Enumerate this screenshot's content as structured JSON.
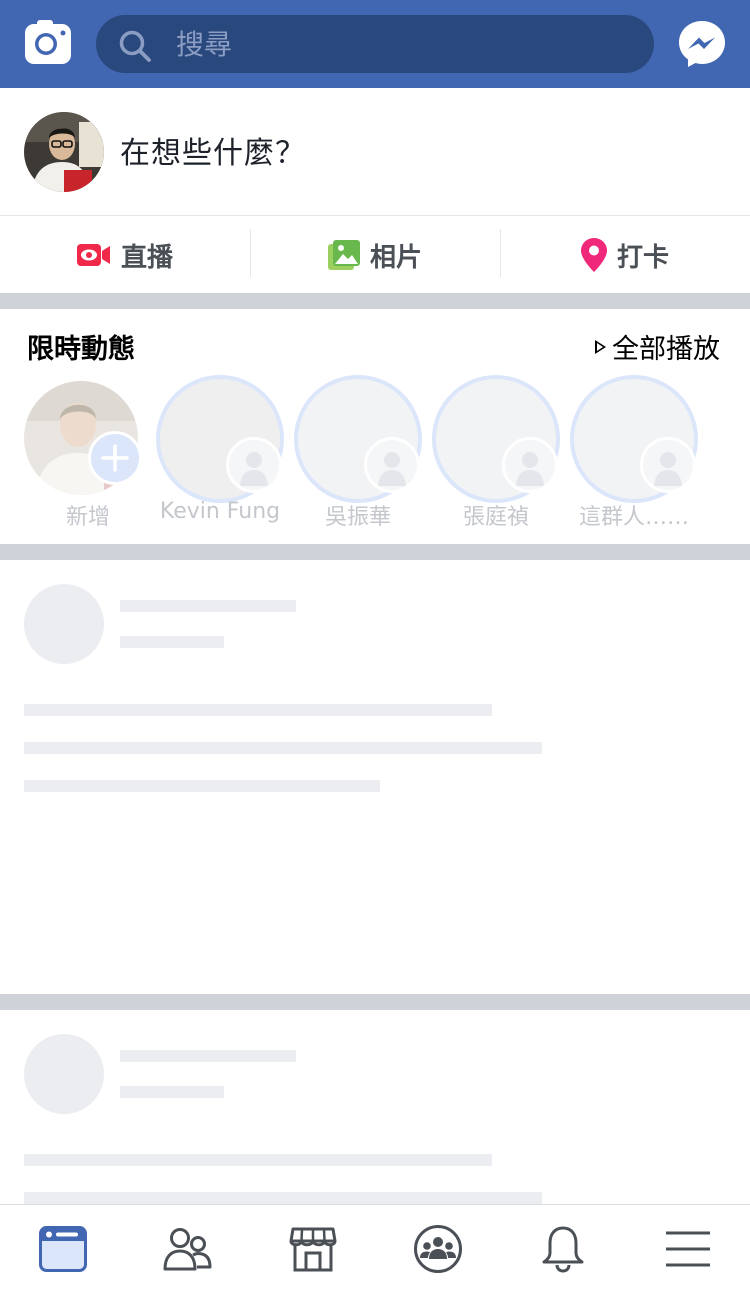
{
  "header": {
    "camera_icon": "camera-icon",
    "search": {
      "placeholder": "搜尋",
      "value": ""
    },
    "messenger_icon": "messenger-icon",
    "bar_color": "#4267b2"
  },
  "composer": {
    "prompt": "在想些什麼？"
  },
  "actions": [
    {
      "label": "直播",
      "icon": "live-video-icon"
    },
    {
      "label": "相片",
      "icon": "photo-icon"
    },
    {
      "label": "打卡",
      "icon": "check-in-icon"
    }
  ],
  "stories": {
    "title": "限時動態",
    "play_all": "全部播放",
    "items": [
      {
        "label": "新增"
      },
      {
        "label": "Kevin Fung"
      },
      {
        "label": "吳振華"
      },
      {
        "label": "張庭禎"
      },
      {
        "label": "這群人……"
      }
    ]
  },
  "tabbar": {
    "items": [
      {
        "icon": "news-feed-icon",
        "active": true
      },
      {
        "icon": "friends-icon",
        "active": false
      },
      {
        "icon": "marketplace-icon",
        "active": false
      },
      {
        "icon": "groups-icon",
        "active": false
      },
      {
        "icon": "notifications-bell-icon",
        "active": false
      },
      {
        "icon": "menu-icon",
        "active": false
      }
    ],
    "active_color": "#4267b2",
    "inactive_color": "#4b4f56"
  }
}
